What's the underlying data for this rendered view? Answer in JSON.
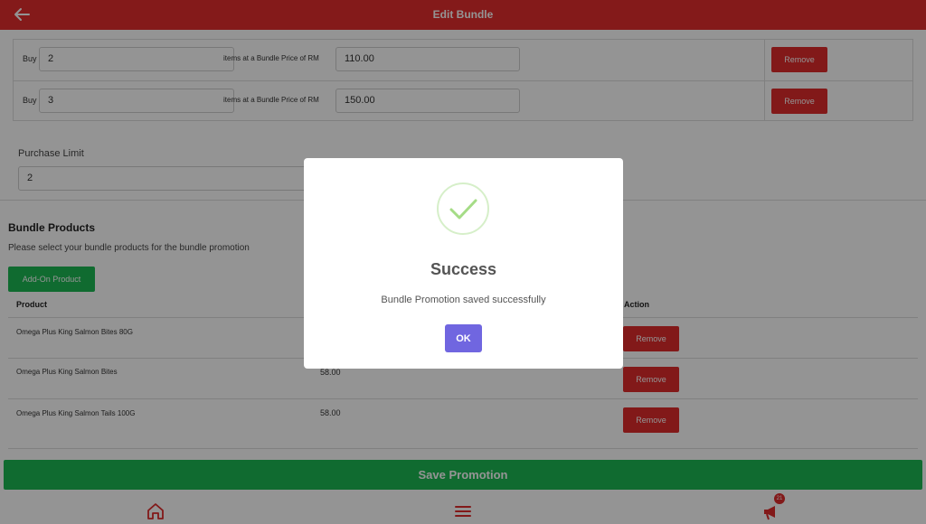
{
  "header": {
    "title": "Edit Bundle"
  },
  "tiers": {
    "buy_label": "Buy",
    "mid_label": "items at a Bundle Price of RM",
    "remove_label": "Remove",
    "rows": [
      {
        "quantity": "2",
        "price": "110.00"
      },
      {
        "quantity": "3",
        "price": "150.00"
      }
    ]
  },
  "purchase_limit": {
    "label": "Purchase Limit",
    "value": "2"
  },
  "bundle_products": {
    "title": "Bundle Products",
    "description": "Please select your bundle products for the bundle promotion",
    "add_button": "Add-On Product",
    "columns": {
      "product": "Product",
      "action": "Action"
    },
    "remove_label": "Remove",
    "rows": [
      {
        "name": "Omega Plus King Salmon Bites 80G",
        "price": ""
      },
      {
        "name": "Omega Plus King Salmon Bites",
        "price": "58.00"
      },
      {
        "name": "Omega Plus King Salmon Tails 100G",
        "price": "58.00"
      }
    ]
  },
  "save_button": "Save Promotion",
  "bottom_nav": {
    "items": [
      "home-icon",
      "menu-icon",
      "promotion-icon"
    ],
    "badge_count": "21"
  },
  "modal": {
    "title": "Success",
    "message": "Bundle Promotion saved successfully",
    "ok_label": "OK"
  },
  "colors": {
    "header": "#e32e2e",
    "remove": "#e02b2b",
    "green": "#1db954",
    "ok": "#7066e0",
    "check": "#a5dc86"
  }
}
